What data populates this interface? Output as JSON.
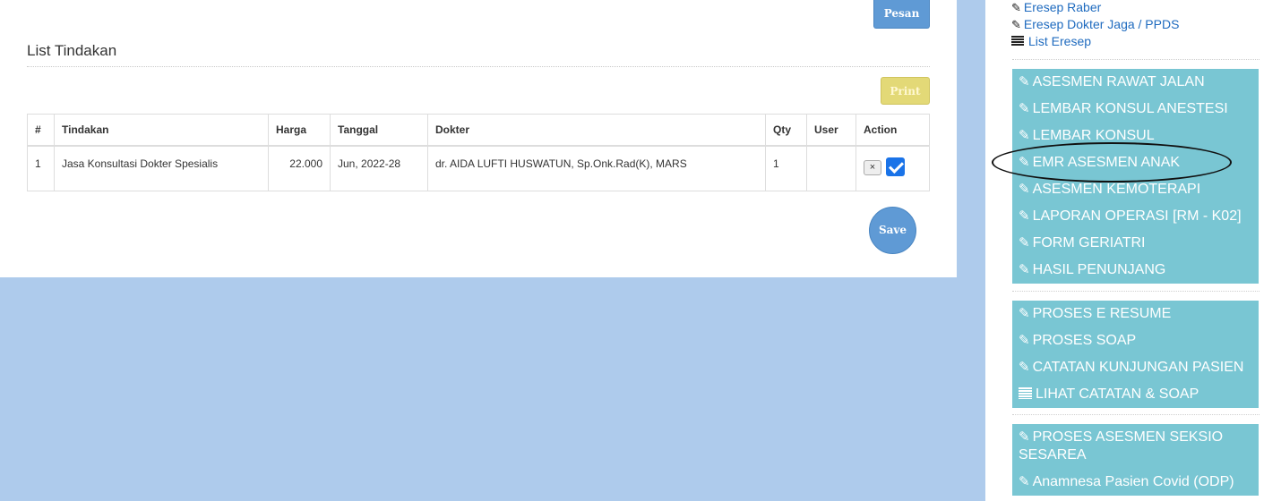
{
  "main": {
    "pesan_label": "Pesan",
    "section_title": "List Tindakan",
    "print_label": "Print",
    "save_label": "Save",
    "table": {
      "headers": [
        "#",
        "Tindakan",
        "Harga",
        "Tanggal",
        "Dokter",
        "Qty",
        "User",
        "Action"
      ],
      "rows": [
        {
          "no": "1",
          "tindakan": "Jasa Konsultasi Dokter Spesialis",
          "harga": "22.000",
          "tanggal": "Jun, 2022-28",
          "dokter": "dr. AIDA LUFTI HUSWATUN, Sp.Onk.Rad(K), MARS",
          "qty": "1",
          "user": "",
          "action_remove": "×"
        }
      ]
    }
  },
  "sidebar": {
    "links": [
      {
        "label": "Eresep Raber",
        "icon": "edit-icon"
      },
      {
        "label": "Eresep Dokter Jaga / PPDS",
        "icon": "edit-icon"
      },
      {
        "label": "List Eresep",
        "icon": "list-icon"
      }
    ],
    "group1": [
      {
        "label": "ASESMEN RAWAT JALAN",
        "icon": "edit-icon"
      },
      {
        "label": "LEMBAR KONSUL ANESTESI",
        "icon": "edit-icon"
      },
      {
        "label": "LEMBAR KONSUL",
        "icon": "edit-icon"
      },
      {
        "label": "EMR ASESMEN ANAK",
        "icon": "edit-icon"
      },
      {
        "label": "ASESMEN KEMOTERAPI",
        "icon": "edit-icon"
      },
      {
        "label": "LAPORAN OPERASI [RM - K02]",
        "icon": "edit-icon"
      },
      {
        "label": "FORM GERIATRI",
        "icon": "edit-icon"
      },
      {
        "label": "HASIL PENUNJANG",
        "icon": "edit-icon"
      }
    ],
    "group2": [
      {
        "label": "PROSES E RESUME",
        "icon": "edit-icon"
      },
      {
        "label": "PROSES SOAP",
        "icon": "edit-icon"
      },
      {
        "label": "CATATAN KUNJUNGAN PASIEN",
        "icon": "edit-icon"
      },
      {
        "label": "LIHAT CATATAN & SOAP",
        "icon": "list-icon"
      }
    ],
    "group3": [
      {
        "label": "PROSES ASESMEN SEKSIO SESAREA",
        "icon": "edit-icon"
      },
      {
        "label": "Anamnesa Pasien Covid (ODP)",
        "icon": "edit-icon"
      }
    ]
  },
  "colors": {
    "page_bg": "#aecbec",
    "sidebar_button": "#79c6d3",
    "primary_button": "#5f9ad5",
    "print_button": "#e3d977",
    "checkbox": "#1a73e8"
  }
}
